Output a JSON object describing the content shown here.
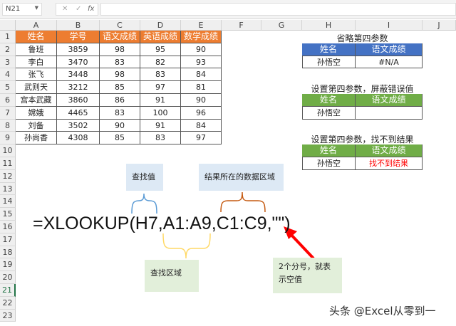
{
  "formula_bar": {
    "name_box": "N21",
    "cancel": "✕",
    "confirm": "✓",
    "fx": "fx",
    "content": ""
  },
  "columns": [
    "A",
    "B",
    "C",
    "D",
    "E",
    "F",
    "G",
    "H",
    "I",
    "J"
  ],
  "rows": [
    "1",
    "2",
    "3",
    "4",
    "5",
    "6",
    "7",
    "8",
    "9",
    "10",
    "11",
    "12",
    "13",
    "14",
    "15",
    "16",
    "17",
    "18",
    "19",
    "20",
    "21",
    "22",
    "23"
  ],
  "table": {
    "headers": [
      "姓名",
      "学号",
      "语文成绩",
      "英语成绩",
      "数学成绩"
    ],
    "data": [
      [
        "鲁班",
        "3859",
        "98",
        "95",
        "90"
      ],
      [
        "李白",
        "3470",
        "83",
        "82",
        "93"
      ],
      [
        "张飞",
        "3448",
        "98",
        "83",
        "84"
      ],
      [
        "武则天",
        "3212",
        "85",
        "97",
        "81"
      ],
      [
        "宫本武藏",
        "3860",
        "86",
        "91",
        "90"
      ],
      [
        "嫦娥",
        "4465",
        "83",
        "100",
        "96"
      ],
      [
        "刘备",
        "3502",
        "90",
        "91",
        "84"
      ],
      [
        "孙尚香",
        "4308",
        "85",
        "83",
        "97"
      ]
    ]
  },
  "examples": [
    {
      "title": "省略第四参数",
      "headers": [
        "姓名",
        "语文成绩"
      ],
      "values": [
        "孙悟空",
        "#N/A"
      ],
      "color": "#4472c4"
    },
    {
      "title": "设置第四参数，屏蔽错误值",
      "headers": [
        "姓名",
        "语文成绩"
      ],
      "values": [
        "孙悟空",
        ""
      ],
      "color": "#70ad47"
    },
    {
      "title": "设置第四参数，找不到结果",
      "headers": [
        "姓名",
        "语文成绩"
      ],
      "values": [
        "孙悟空",
        "找不到结果"
      ],
      "color": "#70ad47"
    }
  ],
  "formula": "=XLOOKUP(H7,A1:A9,C1:C9,\"\")",
  "callouts": {
    "lookup_value": "查找值",
    "result_range": "结果所在的数据区域",
    "lookup_range": "查找区域",
    "note": "2个分号，就表示空值"
  },
  "watermark": "头条 @Excel从零到一",
  "colors": {
    "orange_header": "#ed7d31",
    "blue_header": "#4472c4",
    "green_header": "#70ad47",
    "error_text": "#ff0000"
  }
}
